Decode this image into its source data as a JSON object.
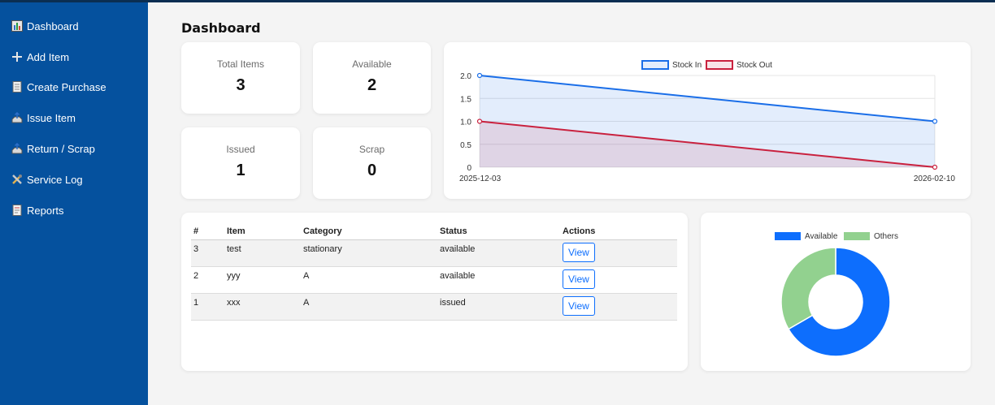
{
  "sidebar": {
    "items": [
      {
        "label": "Dashboard",
        "icon": "bar-chart-icon"
      },
      {
        "label": "Add Item",
        "icon": "plus-icon"
      },
      {
        "label": "Create Purchase",
        "icon": "document-icon"
      },
      {
        "label": "Issue Item",
        "icon": "outbox-icon"
      },
      {
        "label": "Return / Scrap",
        "icon": "outbox-icon"
      },
      {
        "label": "Service Log",
        "icon": "tools-icon"
      },
      {
        "label": "Reports",
        "icon": "report-icon"
      }
    ]
  },
  "header": {
    "title": "Dashboard"
  },
  "stats": {
    "total": {
      "label": "Total Items",
      "value": "3"
    },
    "available": {
      "label": "Available",
      "value": "2"
    },
    "issued": {
      "label": "Issued",
      "value": "1"
    },
    "scrap": {
      "label": "Scrap",
      "value": "0"
    }
  },
  "table": {
    "columns": [
      "#",
      "Item",
      "Category",
      "Status",
      "Actions"
    ],
    "rows": [
      {
        "id": "3",
        "item": "test",
        "category": "stationary",
        "status": "available",
        "action": "View"
      },
      {
        "id": "2",
        "item": "yyy",
        "category": "A",
        "status": "available",
        "action": "View"
      },
      {
        "id": "1",
        "item": "xxx",
        "category": "A",
        "status": "issued",
        "action": "View"
      }
    ]
  },
  "chart_data": [
    {
      "type": "area",
      "x": [
        "2025-12-03",
        "2026-02-10"
      ],
      "series": [
        {
          "name": "Stock In",
          "values": [
            2,
            1
          ],
          "color": "#1a6ee8"
        },
        {
          "name": "Stock Out",
          "values": [
            1,
            0
          ],
          "color": "#c9213e"
        }
      ],
      "yticks": [
        "0",
        "0.5",
        "1.0",
        "1.5",
        "2.0"
      ],
      "ylim": [
        0,
        2
      ],
      "grid": true,
      "legend": "top"
    },
    {
      "type": "pie",
      "donut": true,
      "labels": [
        "Available",
        "Others"
      ],
      "values": [
        2,
        1
      ],
      "colors": [
        "#0d6efd",
        "#92d18f"
      ],
      "legend": "top"
    }
  ]
}
